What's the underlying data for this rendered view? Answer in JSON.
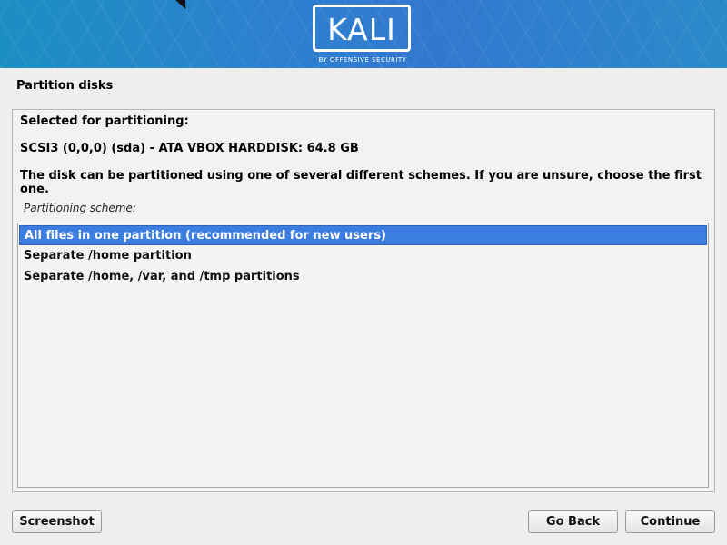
{
  "banner": {
    "logo_text": "KALI",
    "logo_subtitle": "BY OFFENSIVE SECURITY"
  },
  "page": {
    "title": "Partition disks"
  },
  "main": {
    "selected_heading": "Selected for partitioning:",
    "disk_info": "SCSI3 (0,0,0) (sda) - ATA VBOX HARDDISK: 64.8 GB",
    "description": "The disk can be partitioned using one of several different schemes. If you are unsure, choose the first one.",
    "scheme_label": "Partitioning scheme:",
    "schemes": [
      "All files in one partition (recommended for new users)",
      "Separate /home partition",
      "Separate /home, /var, and /tmp partitions"
    ]
  },
  "buttons": {
    "screenshot": "Screenshot",
    "go_back": "Go Back",
    "continue": "Continue"
  }
}
